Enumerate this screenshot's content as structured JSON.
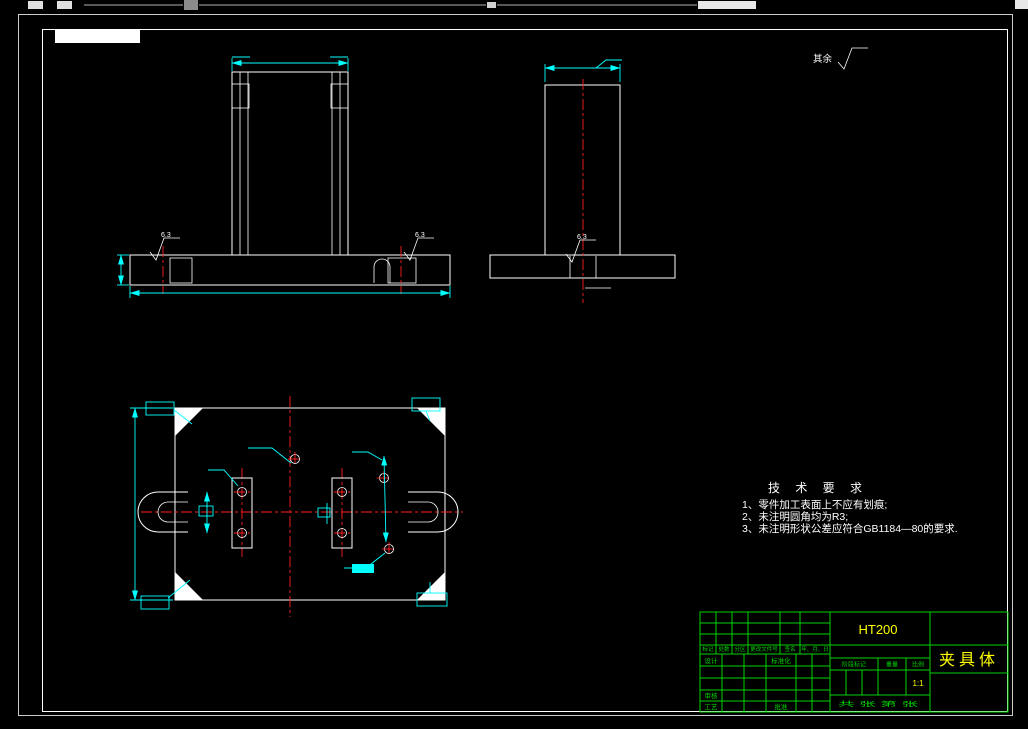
{
  "colors": {
    "background": "#000000",
    "outline": "#ffffff",
    "dimension": "#00ffff",
    "centerline": "#ff2020",
    "title_block_grid": "#00d400",
    "value_text": "#ffff00"
  },
  "notes": {
    "surface_default_label": "其余"
  },
  "roughness": [
    "6.3",
    "6.3",
    "6.3"
  ],
  "tech": {
    "title": "技 术 要 求",
    "items": [
      "1、零件加工表面上不应有划痕;",
      "2、未注明圆角均为R3;",
      "3、未注明形状公差应符合GB1184—80的要求."
    ]
  },
  "title_block": {
    "material": "HT200",
    "part_name": "夹具体",
    "revision_header": [
      "标记",
      "处数",
      "分区",
      "更改文件号",
      "签名",
      "年、月、日"
    ],
    "design_label": "设计",
    "standardization_label": "标准化",
    "review_label": "审核",
    "process_label": "工艺",
    "approve_label": "批准",
    "stage_label": "阶段标记",
    "weight_label": "重量",
    "scale_label": "比例",
    "scale_value": "1:1",
    "sheet_label": "共 张 第 张"
  }
}
